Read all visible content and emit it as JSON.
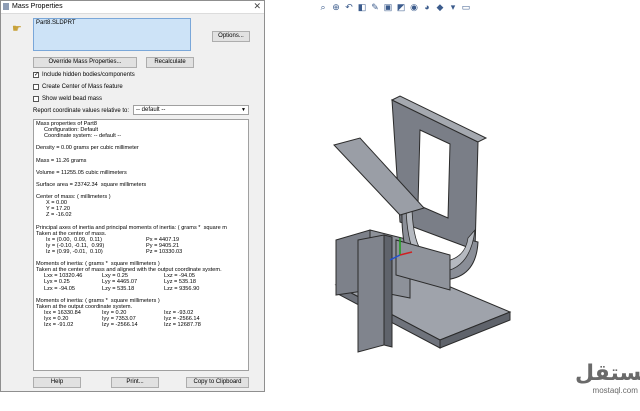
{
  "window": {
    "title": "Mass Properties"
  },
  "selection": {
    "item": "Part8.SLDPRT"
  },
  "buttons": {
    "options": "Options...",
    "override": "Override Mass Properties...",
    "recalculate": "Recalculate",
    "help": "Help",
    "print": "Print...",
    "copy": "Copy to Clipboard"
  },
  "checkboxes": [
    {
      "label": "Include hidden bodies/components",
      "checked": true
    },
    {
      "label": "Create Center of Mass feature",
      "checked": false
    },
    {
      "label": "Show weld bead mass",
      "checked": false
    }
  ],
  "report": {
    "label": "Report coordinate values relative to:",
    "value": "-- default --"
  },
  "results": {
    "header": "Mass properties of Part8",
    "configuration": "Configuration: Default",
    "coord_system": "Coordinate system: -- default --",
    "density": "Density = 0.00 grams per cubic millimeter",
    "mass": "Mass = 11.26 grams",
    "volume": "Volume = 11255.05 cubic millimeters",
    "surface_area": "Surface area = 23742.34  square millimeters",
    "com_title": "Center of mass: ( millimeters )",
    "com_x": "X = 0.00",
    "com_y": "Y = 17.20",
    "com_z": "Z = -16.02",
    "principal_title": "Principal axes of inertia and principal moments of inertia: ( grams *  square m",
    "principal_sub": "Taken at the center of mass.",
    "principal_rows": [
      [
        "Ix = (0.00,  0.09,  0.11)",
        "",
        "Px = 4407.19"
      ],
      [
        "Iy = (-0.10, -0.11,  0.99)",
        "",
        "Py = 9405.21"
      ],
      [
        "Iz = (0.99, -0.01,  0.10)",
        "",
        "Pz = 10330.03"
      ]
    ],
    "moi_com_title": "Moments of inertia: ( grams *  square millimeters )",
    "moi_com_sub": "Taken at the center of mass and aligned with the output coordinate system.",
    "moi_com_rows": [
      [
        "Lxx = 10320.46",
        "Lxy = 0.25",
        "Lxz = -94.05"
      ],
      [
        "Lyx = 0.25",
        "Lyy = 4465.07",
        "Lyz = 535.18"
      ],
      [
        "Lzx = -94.05",
        "Lzy = 535.18",
        "Lzz = 9356.90"
      ]
    ],
    "moi_out_title": "Moments of inertia: ( grams *  square millimeters )",
    "moi_out_sub": "Taken at the output coordinate system.",
    "moi_out_rows": [
      [
        "Ixx = 16330.84",
        "Ixy = 0.20",
        "Ixz = -93.02"
      ],
      [
        "Iyx = 0.20",
        "Iyy = 7353.07",
        "Iyz = -2566.14"
      ],
      [
        "Izx = -91.02",
        "Izy = -2566.14",
        "Izz = 12687.78"
      ]
    ]
  },
  "watermark": {
    "arabic": "مستقل",
    "latin": "mostaql.com"
  },
  "toolbar_icons": [
    "search-icon",
    "zoom-area-icon",
    "previous-view-icon",
    "section-view-icon",
    "dynamic-annotation-icon",
    "view-orientation-icon",
    "display-style-icon",
    "hide-show-icon",
    "edit-appearance-icon",
    "apply-scene-icon",
    "view-settings-icon",
    "monitor-icon"
  ]
}
